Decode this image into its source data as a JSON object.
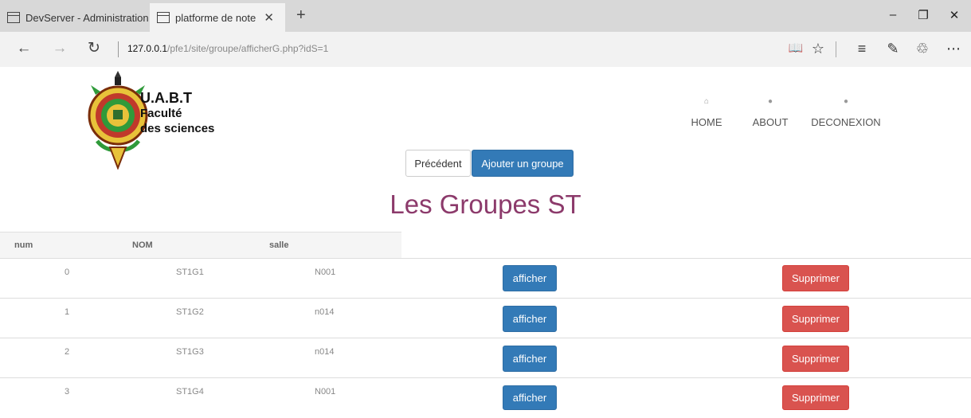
{
  "browser": {
    "tabs": [
      {
        "title": "DevServer - Administration"
      },
      {
        "title": "platforme de note"
      }
    ],
    "url_host": "127.0.0.1",
    "url_path": "/pfe1/site/groupe/afficherG.php?idS=1"
  },
  "brand": {
    "line1": "U.A.B.T",
    "line2": "Faculté",
    "line3": "des sciences"
  },
  "nav": [
    {
      "label": "HOME",
      "icon": "home-icon"
    },
    {
      "label": "ABOUT",
      "icon": "user-icon"
    },
    {
      "label": "DECONEXION",
      "icon": "user-icon"
    }
  ],
  "actions": {
    "previous": "Précédent",
    "add_group": "Ajouter un groupe"
  },
  "page_title": "Les Groupes ST",
  "table": {
    "headers": [
      "num",
      "NOM",
      "salle"
    ],
    "view_label": "afficher",
    "delete_label": "Supprimer",
    "rows": [
      {
        "num": "0",
        "nom": "ST1G1",
        "salle": "N001"
      },
      {
        "num": "1",
        "nom": "ST1G2",
        "salle": "n014"
      },
      {
        "num": "2",
        "nom": "ST1G3",
        "salle": "n014"
      },
      {
        "num": "3",
        "nom": "ST1G4",
        "salle": "N001"
      }
    ]
  },
  "colors": {
    "title": "#8c3a6b",
    "primary": "#337ab7",
    "danger": "#d9534f"
  }
}
